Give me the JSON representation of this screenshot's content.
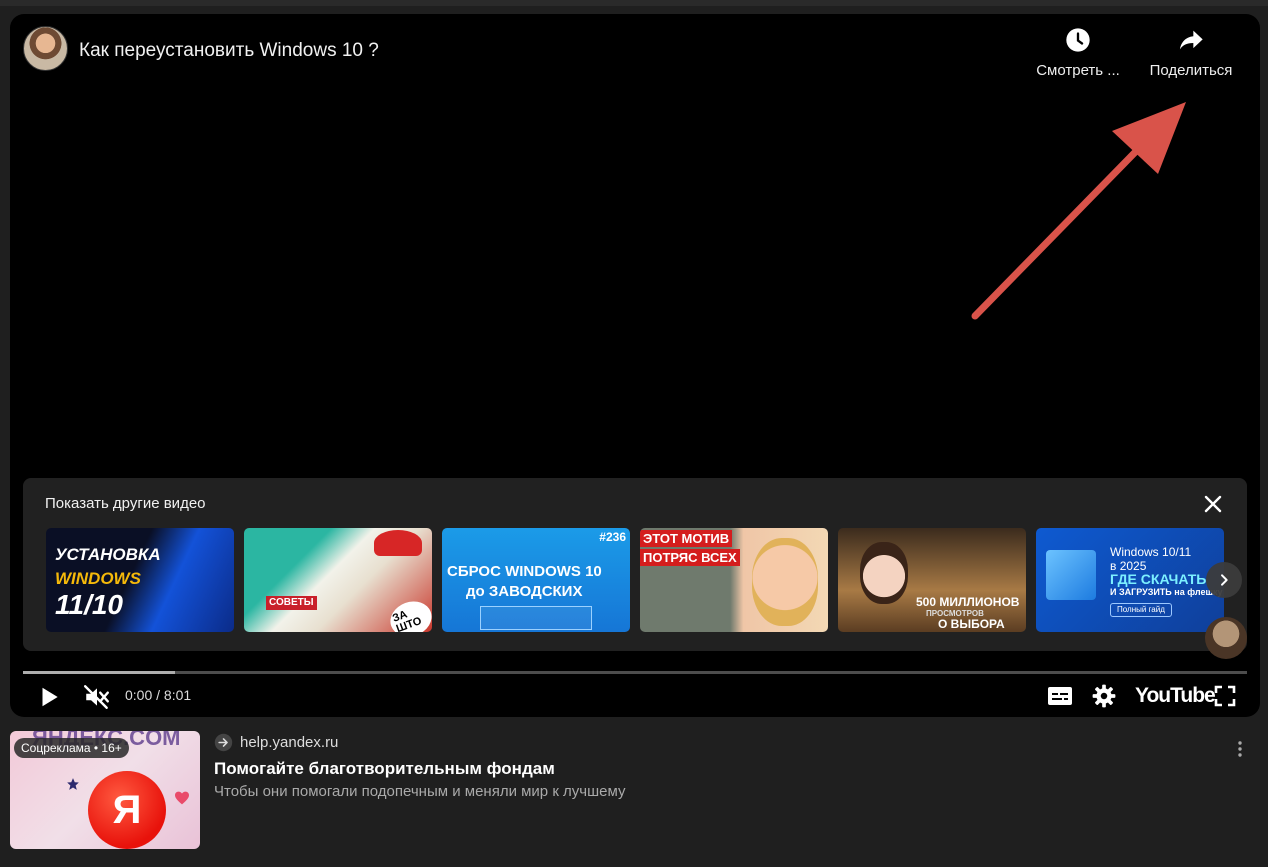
{
  "player": {
    "video_title": "Как переустановить Windows 10 ?",
    "watch_later_label": "Смотреть ...",
    "share_label": "Поделиться",
    "more_videos_title": "Показать другие видео",
    "time_display": "0:00 / 8:01",
    "brand_label": "YouTube",
    "progress": {
      "buffered_fraction": 0.124,
      "played_fraction": 0
    },
    "thumbnails": [
      {
        "lines": [
          "УСТАНОВКА",
          "WINDOWS",
          "11/10"
        ]
      },
      {
        "lines": [
          "СОВЕТЫ",
          "ЗА ШТО"
        ]
      },
      {
        "lines": [
          "СБРОС WINDOWS 10",
          "до ЗАВОДСКИХ",
          "#236"
        ]
      },
      {
        "lines": [
          "ЭТОТ МОТИВ",
          "ПОТРЯС ВСЕХ"
        ]
      },
      {
        "lines": [
          "500 МИЛЛИОНОВ",
          "ПРОСМОТРОВ",
          "О ВЫБОРА"
        ]
      },
      {
        "lines": [
          "Windows 10/11",
          "в 2025",
          "ГДЕ СКАЧАТЬ",
          "И ЗАГРУЗИТЬ на флешку",
          "Полный гайд"
        ]
      }
    ],
    "icons": {
      "watch_later": "clock-icon",
      "share": "share-arrow-icon",
      "close": "close-icon",
      "next": "chevron-right-icon",
      "play": "play-icon",
      "mute": "muted-speaker-icon",
      "captions": "captions-icon",
      "settings": "gear-icon",
      "fullscreen": "fullscreen-icon"
    },
    "annotation_arrow_color": "#d9534a"
  },
  "ad": {
    "badge": "Соцреклама • 16+",
    "logo_letter": "Я",
    "ghost_text": "ЯНДЕКС.COM",
    "domain": "help.yandex.ru",
    "title": "Помогайте благотворительным фондам",
    "description": "Чтобы они помогали подопечным и меняли мир к лучшему",
    "accent_color": "#e8120b"
  }
}
